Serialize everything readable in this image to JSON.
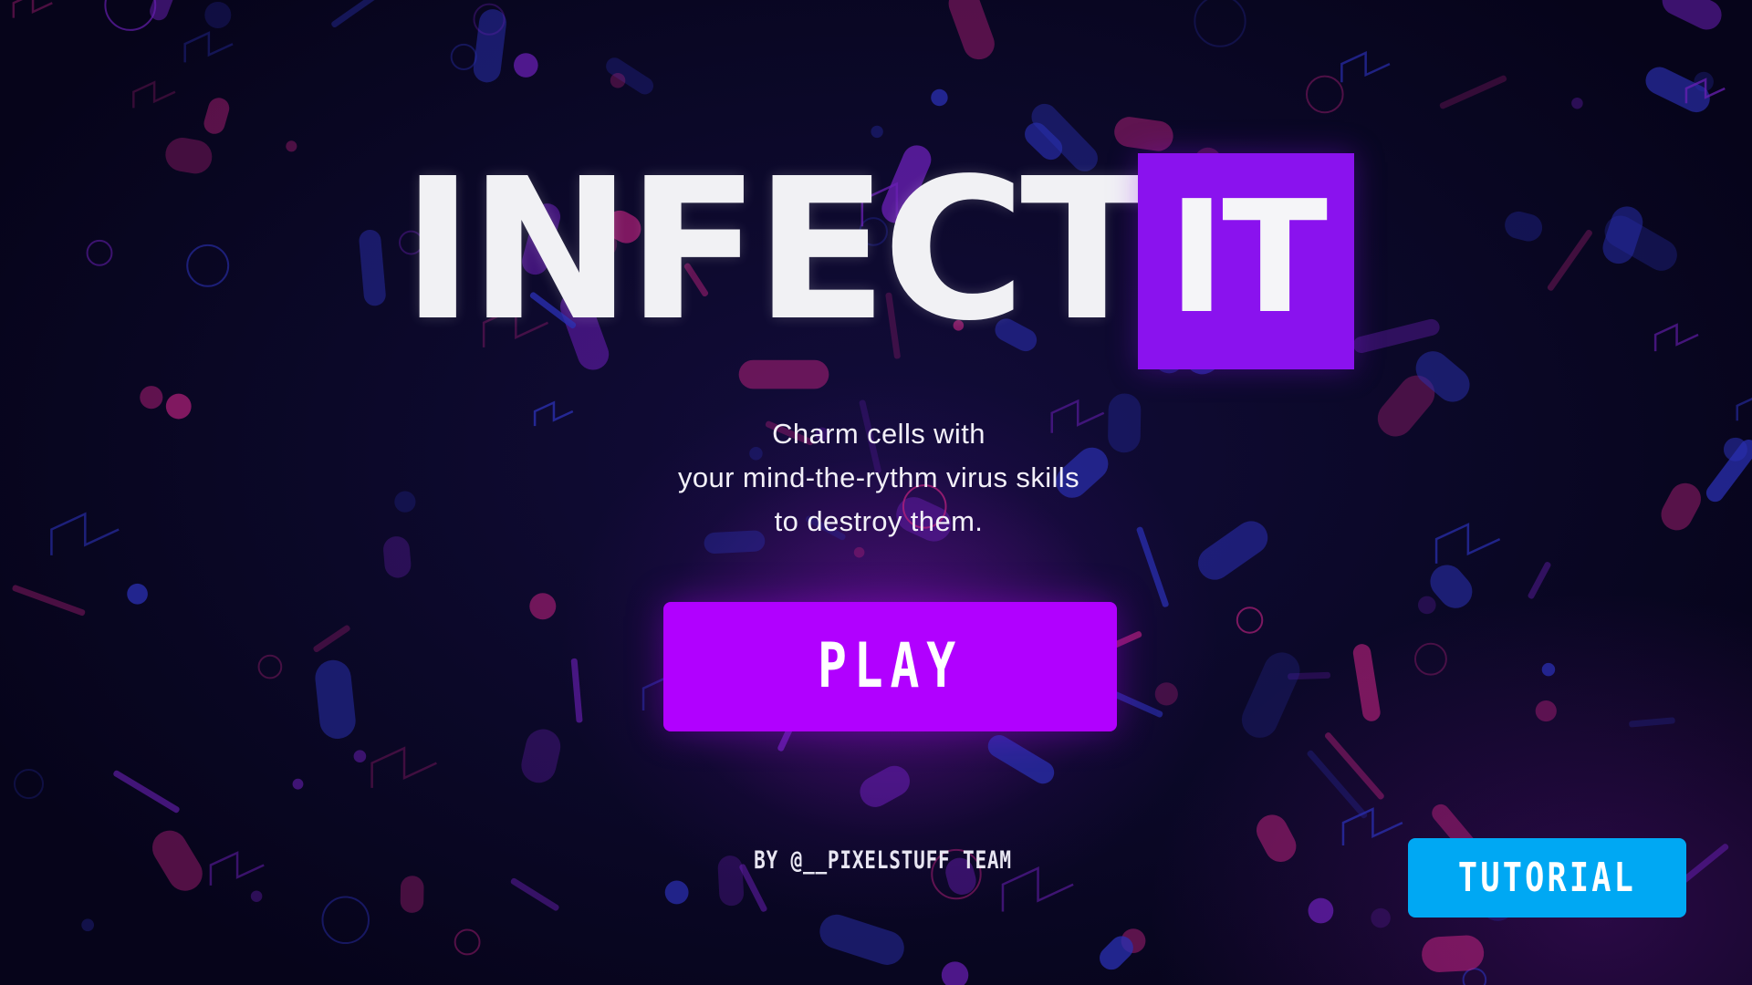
{
  "game": {
    "title_main": "INFECT",
    "title_highlight": "IT",
    "tagline": [
      "Charm cells with",
      "your mind-the-rythm virus skills",
      "to destroy them."
    ],
    "play_label": "PLAY",
    "credits": "BY @__PIXELSTUFF TEAM",
    "tutorial_label": "TUTORIAL"
  },
  "colors": {
    "background": "#08061e",
    "title_text": "#f1f1f4",
    "title_box": "#8a12ee",
    "play_button": "#b100ff",
    "tutorial_button": "#00a8f3",
    "particle_magenta": "#b4207a",
    "particle_purple": "#6a1fb5",
    "particle_blue": "#2a2fb0"
  }
}
